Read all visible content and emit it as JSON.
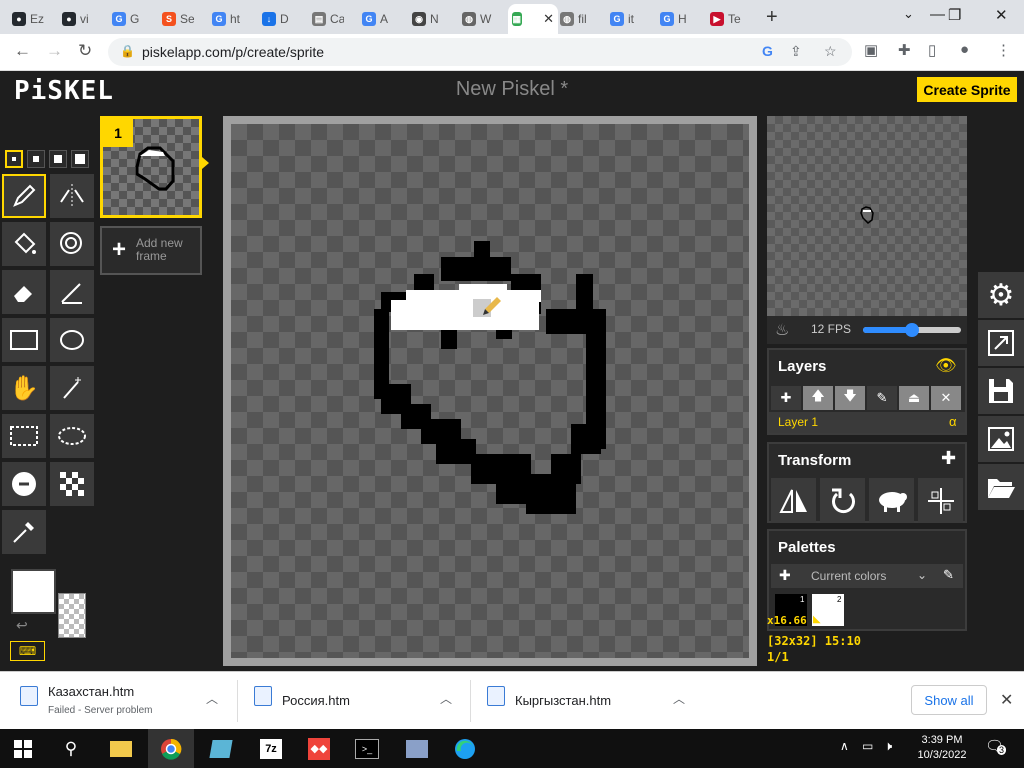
{
  "browser": {
    "tabs": [
      {
        "label": "Ez",
        "color": "#24292f",
        "glyph": "●"
      },
      {
        "label": "vi",
        "color": "#24292f",
        "glyph": "●"
      },
      {
        "label": "G",
        "color": "#4285f4",
        "glyph": "G"
      },
      {
        "label": "Se",
        "color": "#f4511e",
        "glyph": "S"
      },
      {
        "label": "ht",
        "color": "#4285f4",
        "glyph": "G"
      },
      {
        "label": "D",
        "color": "#1a73e8",
        "glyph": "↓"
      },
      {
        "label": "Ca",
        "color": "#777777",
        "glyph": "▤"
      },
      {
        "label": "A",
        "color": "#4285f4",
        "glyph": "G"
      },
      {
        "label": "N",
        "color": "#444444",
        "glyph": "◉"
      },
      {
        "label": "W",
        "color": "#666666",
        "glyph": "◍"
      },
      {
        "label": "",
        "color": "#34a853",
        "glyph": "▦"
      },
      {
        "label": "fil",
        "color": "#777777",
        "glyph": "◍"
      },
      {
        "label": "it",
        "color": "#4285f4",
        "glyph": "G"
      },
      {
        "label": "H",
        "color": "#4285f4",
        "glyph": "G"
      },
      {
        "label": "Te",
        "color": "#c8102e",
        "glyph": "▶"
      }
    ],
    "url": "piskelapp.com/p/create/sprite"
  },
  "app": {
    "logo": "PiSKEL",
    "title": "New Piskel *",
    "create_button": "Create Sprite"
  },
  "frames": {
    "frame1_number": "1",
    "add_frame": "Add new frame"
  },
  "preview": {
    "fps": "12 FPS",
    "fps_value": 12,
    "fps_max": 24
  },
  "layers": {
    "title": "Layers",
    "items": [
      {
        "name": "Layer 1",
        "alpha": "α"
      }
    ]
  },
  "transform": {
    "title": "Transform"
  },
  "palettes": {
    "title": "Palettes",
    "selected": "Current colors",
    "colors": [
      {
        "index": "1",
        "hex": "#000000"
      },
      {
        "index": "2",
        "hex": "#ffffff"
      }
    ]
  },
  "status": {
    "zoom": "x16.66",
    "size": "[32x32] 15:10",
    "frame": "1/1"
  },
  "colors": {
    "primary": "#ffffff",
    "accent": "#ffd700"
  },
  "downloads": {
    "items": [
      {
        "name": "Казахстан.htm",
        "status": "Failed - Server problem"
      },
      {
        "name": "Россия.htm",
        "status": ""
      },
      {
        "name": "Кыргызстан.htm",
        "status": ""
      }
    ],
    "show_all": "Show all"
  },
  "taskbar": {
    "time": "3:39 PM",
    "date": "10/3/2022",
    "notifications": "3"
  }
}
